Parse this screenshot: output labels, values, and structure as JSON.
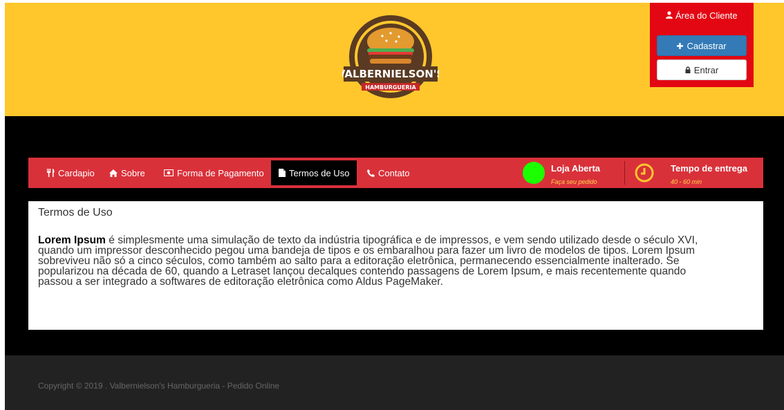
{
  "brand": {
    "logo_name": "VALBERNIELSON'S",
    "logo_sub": "HAMBURGUERIA",
    "colors": {
      "header": "#ffc72c",
      "nav": "#d9313a",
      "client_box": "#e30613",
      "status_open": "#1cff00",
      "footer": "#222222"
    }
  },
  "client": {
    "title": "Área do Cliente",
    "title_icon": "user-icon",
    "register_label": "Cadastrar",
    "register_icon": "plus-icon",
    "login_label": "Entrar",
    "login_icon": "lock-icon"
  },
  "nav": {
    "items": [
      {
        "label": "Cardapio",
        "icon": "cutlery-icon"
      },
      {
        "label": "Sobre",
        "icon": "home-icon"
      },
      {
        "label": "Forma de Pagamento",
        "icon": "money-icon"
      },
      {
        "label": "Termos de Uso",
        "icon": "file-icon",
        "active": true
      },
      {
        "label": "Contato",
        "icon": "phone-icon"
      }
    ],
    "status_title": "Loja Aberta",
    "status_sub": "Faça seu pedido",
    "delivery_title": "Tempo de entrega",
    "delivery_sub": "40 - 60 min",
    "delivery_icon": "clock-icon"
  },
  "content": {
    "title": "Termos de Uso",
    "bold_lead": "Lorem Ipsum",
    "paragraph_lines": [
      " é simplesmente uma simulação de texto da indústria tipográfica e de impressos, e vem sendo utilizado desde o século XVI,",
      "quando um impressor desconhecido pegou uma bandeja de tipos e os embaralhou para fazer um livro de modelos de tipos. Lorem Ipsum",
      "sobreviveu não só a cinco séculos, como também ao salto para a editoração eletrônica, permanecendo essencialmente inalterado. Se",
      "popularizou na década de 60, quando a Letraset lançou decalques contendo passagens de Lorem Ipsum, e mais recentemente quando",
      "passou a ser integrado a softwares de editoração eletrônica como Aldus PageMaker."
    ]
  },
  "footer": {
    "copyright": "Copyright © 2019 . Valbernielson's Hamburgueria - Pedido Online"
  }
}
